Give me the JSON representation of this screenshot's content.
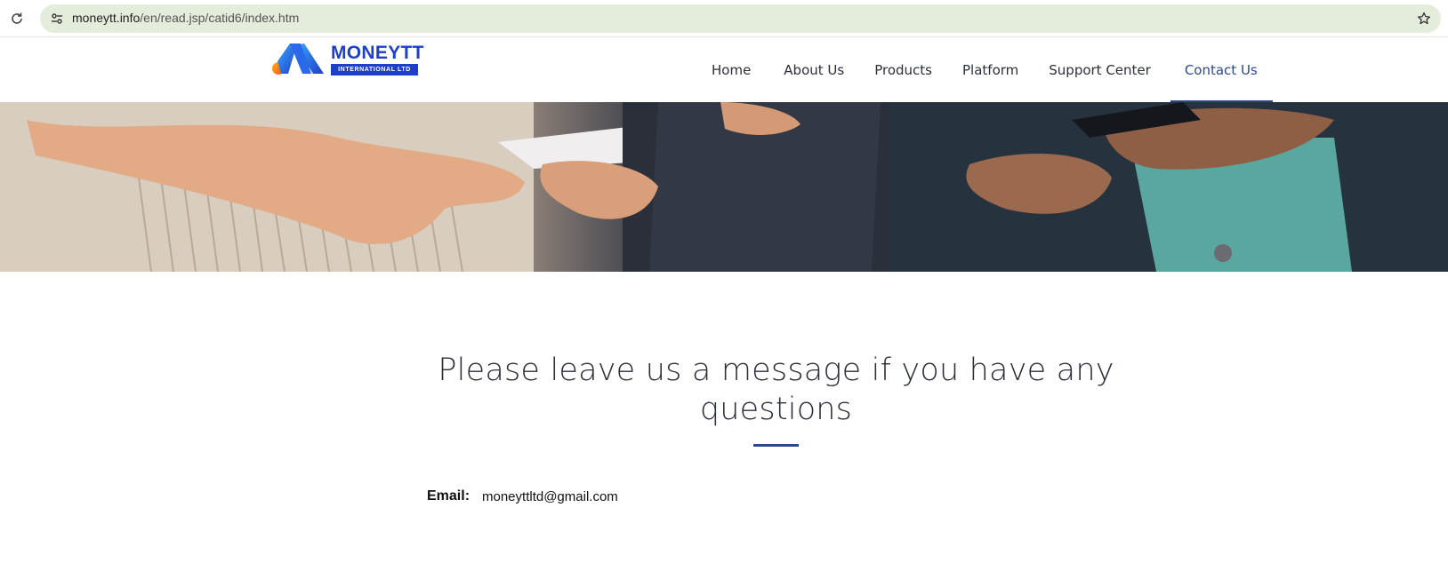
{
  "browser": {
    "url_host": "moneytt.info",
    "url_path": "/en/read.jsp/catid6/index.htm"
  },
  "logo": {
    "name": "MONEYTT",
    "subtitle": "INTERNATIONAL LTD"
  },
  "nav": {
    "items": [
      {
        "label": "Home"
      },
      {
        "label": "About Us"
      },
      {
        "label": "Products"
      },
      {
        "label": "Platform"
      },
      {
        "label": "Support Center"
      },
      {
        "label": "Contact Us"
      }
    ],
    "active": "Contact Us"
  },
  "main": {
    "heading": "Please leave us a message if you have any questions",
    "email_label": "Email:",
    "email_value": "moneyttltd@gmail.com"
  },
  "colors": {
    "brand_blue": "#1e3fc8",
    "nav_active": "#2a4a8c",
    "omnibox_bg": "#e4ecdc"
  }
}
